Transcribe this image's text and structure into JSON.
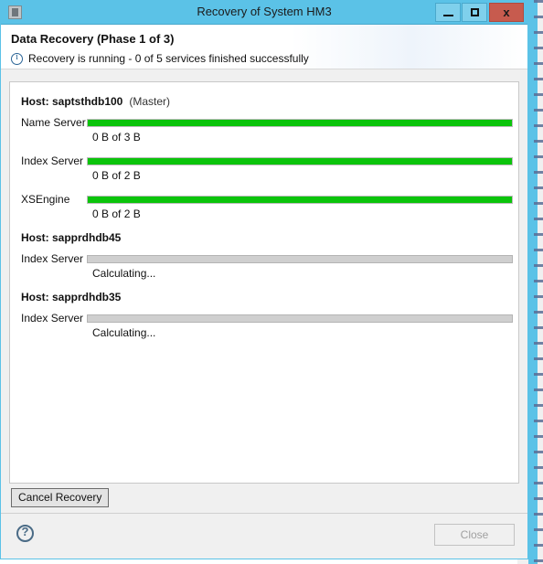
{
  "window": {
    "title": "Recovery of System HM3",
    "app_icon": "application-icon",
    "caption_buttons": {
      "minimize": "minimize-icon",
      "maximize": "maximize-icon",
      "close": "x"
    }
  },
  "header": {
    "title": "Data Recovery (Phase 1 of 3)",
    "status_icon": "info-icon",
    "status_text": "Recovery is running - 0 of 5 services finished successfully"
  },
  "hosts": [
    {
      "label": "Host: saptsthdb100",
      "role": "(Master)",
      "services": [
        {
          "name": "Name Server",
          "sub": "0 B of 3 B",
          "percent": 100,
          "state": "running"
        },
        {
          "name": "Index Server",
          "sub": "0 B of 2 B",
          "percent": 100,
          "state": "running"
        },
        {
          "name": "XSEngine",
          "sub": "0 B of 2 B",
          "percent": 100,
          "state": "running"
        }
      ]
    },
    {
      "label": "Host: sapprdhdb45",
      "role": "",
      "services": [
        {
          "name": "Index Server",
          "sub": "Calculating...",
          "percent": 0,
          "state": "calculating"
        }
      ]
    },
    {
      "label": "Host: sapprdhdb35",
      "role": "",
      "services": [
        {
          "name": "Index Server",
          "sub": "Calculating...",
          "percent": 0,
          "state": "calculating"
        }
      ]
    }
  ],
  "buttons": {
    "cancel_recovery": "Cancel Recovery",
    "close": "Close",
    "help_icon": "help-icon"
  },
  "colors": {
    "titlebar": "#5bc2e7",
    "close_button": "#c75b4e",
    "progress_green": "#0bc40b",
    "progress_empty": "#cfcfcf",
    "info_blue": "#2a6496"
  }
}
